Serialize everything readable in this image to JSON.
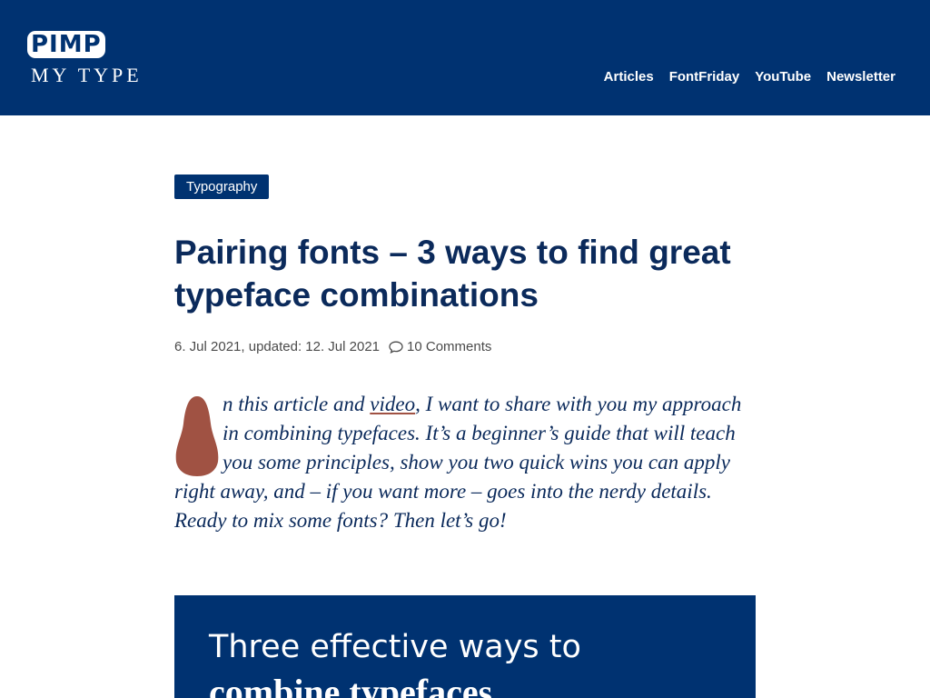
{
  "header": {
    "logo": {
      "top": "PIMP",
      "bottom": "MY TYPE"
    },
    "nav": [
      {
        "label": "Articles"
      },
      {
        "label": "FontFriday"
      },
      {
        "label": "YouTube"
      },
      {
        "label": "Newsletter"
      }
    ]
  },
  "article": {
    "category": "Typography",
    "title": "Pairing fonts – 3 ways to find great typeface combinations",
    "meta": {
      "dates": "6. Jul 2021, updated: 12. Jul 2021",
      "comments": "10 Comments"
    },
    "intro": {
      "dropcap_letter": "I",
      "before_link": "n this article and ",
      "link": "video",
      "after_link": ", I want to share with you my approach in combining typefaces. It’s a beginner’s guide that will teach you some principles, show you two quick wins you can apply right away, and – if you want more – goes into the nerdy details. Ready to mix some fonts? Then let’s go!"
    },
    "hero": {
      "line1": "Three effective ways to",
      "line2": "combine typefaces"
    }
  },
  "colors": {
    "brand": "#003271",
    "text": "#0b2a5b",
    "accent": "#a05243"
  },
  "icons": {
    "comment": "comment-icon",
    "dropcap": "dropcap-shape"
  }
}
